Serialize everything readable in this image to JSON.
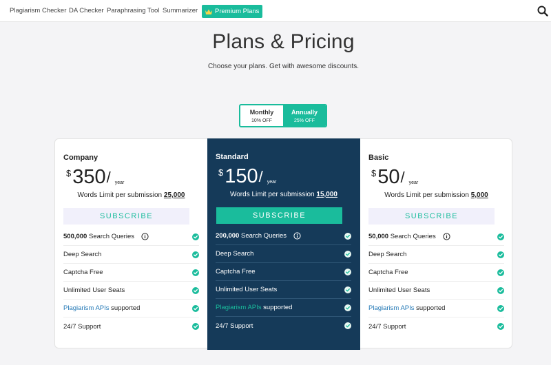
{
  "nav": {
    "links": [
      "Plagiarism Checker",
      "DA Checker",
      "Paraphrasing Tool",
      "Summarizer"
    ],
    "premium": "Premium Plans",
    "icons": {
      "crown": "crown-icon",
      "search": "search-icon"
    }
  },
  "header": {
    "title": "Plans & Pricing",
    "subtitle": "Choose your plans. Get with awesome discounts."
  },
  "billing_toggle": {
    "options": [
      {
        "label": "Monthly",
        "discount": "10% OFF",
        "active": false
      },
      {
        "label": "Annually",
        "discount": "25% OFF",
        "active": true
      }
    ]
  },
  "plans": [
    {
      "name": "Company",
      "currency": "$",
      "price": "350",
      "slash": "/",
      "period": "year",
      "words_label": "Words Limit per submission",
      "words_limit": "25,000",
      "cta": "SUBSCRIBE",
      "features": [
        {
          "bold": "500,000",
          "text": " Search Queries"
        },
        {
          "text": "Deep Search"
        },
        {
          "text": "Captcha Free"
        },
        {
          "text": "Unlimited User Seats"
        },
        {
          "link": "Plagiarism APIs",
          "text": " supported"
        },
        {
          "text": "24/7 Support"
        }
      ]
    },
    {
      "name": "Standard",
      "currency": "$",
      "price": "150",
      "slash": "/",
      "period": "year",
      "words_label": "Words Limit per submission",
      "words_limit": "15,000",
      "cta": "SUBSCRIBE",
      "features": [
        {
          "bold": "200,000",
          "text": " Search Queries"
        },
        {
          "text": "Deep Search"
        },
        {
          "text": "Captcha Free"
        },
        {
          "text": "Unlimited User Seats"
        },
        {
          "link": "Plagiarism APIs",
          "text": " supported"
        },
        {
          "text": "24/7 Support"
        }
      ]
    },
    {
      "name": "Basic",
      "currency": "$",
      "price": "50",
      "slash": "/",
      "period": "year",
      "words_label": "Words Limit per submission",
      "words_limit": "5,000",
      "cta": "SUBSCRIBE",
      "features": [
        {
          "bold": "50,000",
          "text": " Search Queries"
        },
        {
          "text": "Deep Search"
        },
        {
          "text": "Captcha Free"
        },
        {
          "text": "Unlimited User Seats"
        },
        {
          "link": "Plagiarism APIs",
          "text": " supported"
        },
        {
          "text": "24/7 Support"
        }
      ]
    }
  ],
  "colors": {
    "accent": "#1abc9c",
    "featured_bg": "#153a59",
    "link": "#2479b6"
  }
}
